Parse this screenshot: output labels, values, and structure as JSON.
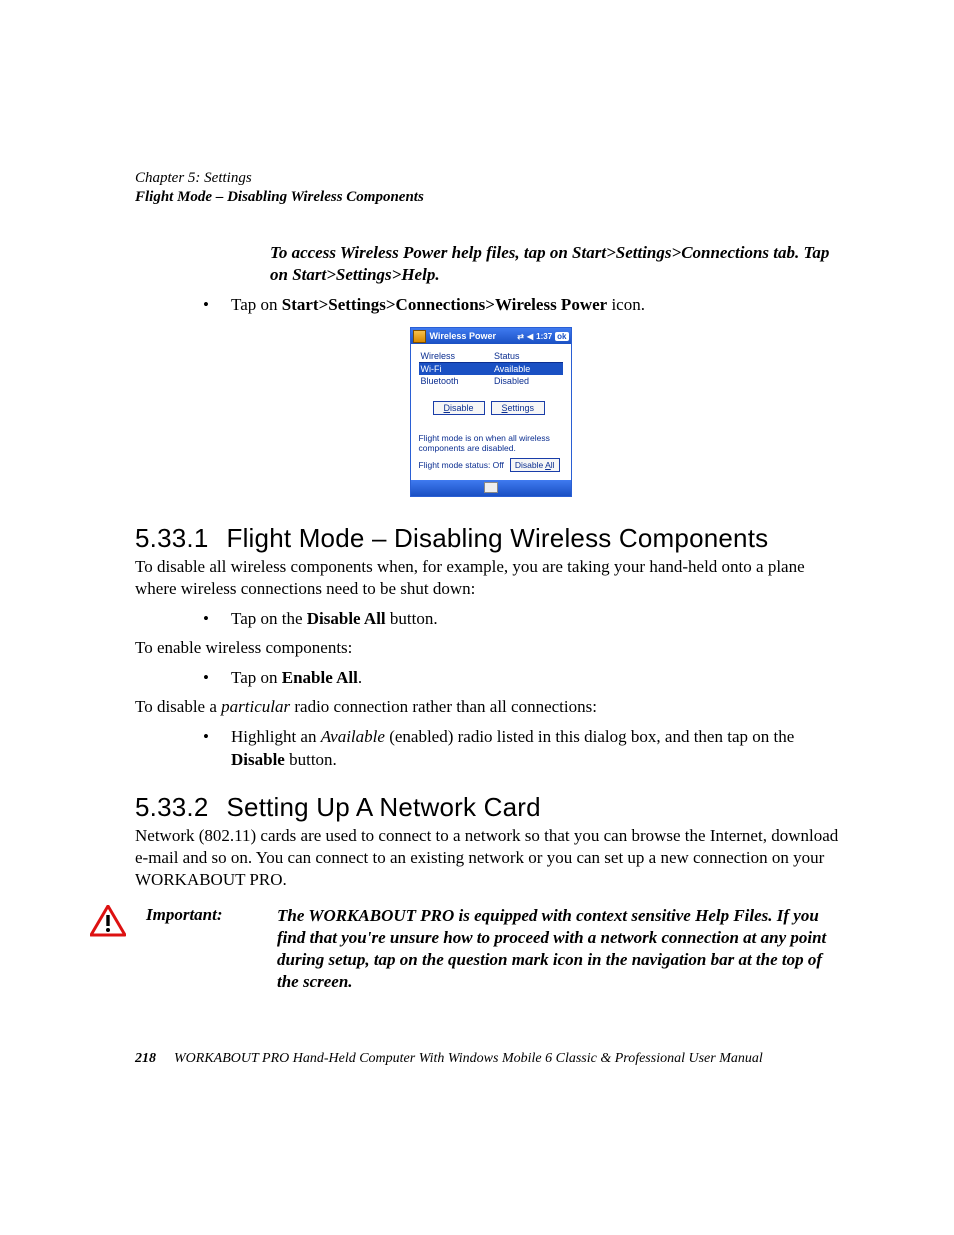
{
  "header": {
    "chapter": "Chapter 5: Settings",
    "section": "Flight Mode – Disabling Wireless Components"
  },
  "intro_note": "To access Wireless Power help files, tap on Start>Settings>Connections tab. Tap on Start>Settings>Help.",
  "bullet_intro": {
    "pre": "Tap on ",
    "bold": "Start>Settings>Connections>Wireless Power",
    "post": " icon."
  },
  "screenshot": {
    "title": "Wireless Power",
    "time": "1:37",
    "ok": "ok",
    "cols": {
      "c1": "Wireless",
      "c2": "Status"
    },
    "rows": [
      {
        "name": "Wi-Fi",
        "status": "Available",
        "selected": true
      },
      {
        "name": "Bluetooth",
        "status": "Disabled",
        "selected": false
      }
    ],
    "btn_disable": "Disable",
    "btn_settings": "Settings",
    "note": "Flight mode is on when all wireless components are disabled.",
    "status_label": "Flight mode status: Off",
    "btn_disable_all": "Disable All"
  },
  "s1": {
    "num": "5.33.1",
    "title": "Flight Mode – Disabling Wireless Components",
    "p1": "To disable all wireless components when, for example, you are taking your hand-held onto a plane where wireless connections need to be shut down:",
    "b1_pre": "Tap on the ",
    "b1_bold": "Disable All",
    "b1_post": " button.",
    "p2": "To enable wireless components:",
    "b2_pre": "Tap on ",
    "b2_bold": "Enable All",
    "b2_post": ".",
    "p3_pre": "To disable a ",
    "p3_it": "particular",
    "p3_post": " radio connection rather than all connections:",
    "b3_pre": "Highlight an ",
    "b3_it": "Available",
    "b3_mid": " (enabled) radio listed in this dialog box, and then tap on the ",
    "b3_bold": "Disable",
    "b3_post": " button."
  },
  "s2": {
    "num": "5.33.2",
    "title": "Setting Up A Network Card",
    "p1": "Network (802.11) cards are used to connect to a network so that you can browse the Internet, download e-mail and so on. You can connect to an existing network or you can set up a new connection on your WORKABOUT PRO."
  },
  "important": {
    "label": "Important:",
    "text": "The WORKABOUT PRO is equipped with context sensitive Help Files. If you find that you're unsure how to proceed with a network connection at any point during setup, tap on the question mark icon in the navigation bar at the top of the screen."
  },
  "footer": {
    "page": "218",
    "text": "WORKABOUT PRO Hand-Held Computer With Windows Mobile 6 Classic & Professional User Manual"
  }
}
